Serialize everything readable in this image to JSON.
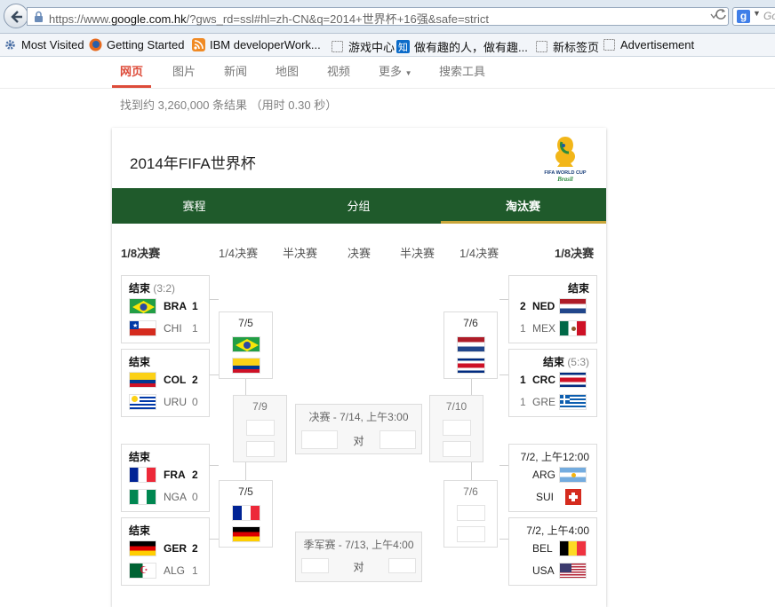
{
  "browser": {
    "url_prefix": "https://www.",
    "url_host": "google.com.hk",
    "url_rest": "/?gws_rd=ssl#hl=zh-CN&q=2014+世界杯+16强&safe=strict",
    "search_placeholder": "Go"
  },
  "bookmarks": [
    {
      "label": "Most Visited",
      "icon": "gear-icon"
    },
    {
      "label": "Getting Started",
      "icon": "firefox-icon"
    },
    {
      "label": "IBM developerWork...",
      "icon": "rss-icon"
    },
    {
      "label": "游戏中心",
      "icon": "page-icon"
    },
    {
      "label": "做有趣的人，做有趣...",
      "icon": "zhihu-icon"
    },
    {
      "label": "新标签页",
      "icon": "page-icon"
    },
    {
      "label": "Advertisement",
      "icon": "page-icon"
    }
  ],
  "google_tabs": [
    "网页",
    "图片",
    "新闻",
    "地图",
    "视频",
    "更多",
    "搜索工具"
  ],
  "result_stats": "找到约 3,260,000 条结果 （用时 0.30 秒）",
  "card": {
    "title": "2014年FIFA世界杯",
    "logo_text": "FIFA WORLD CUP",
    "logo_sub": "Brasil",
    "tabs": [
      "赛程",
      "分组",
      "淘汰赛"
    ],
    "rounds": [
      "1/8决赛",
      "1/4决赛",
      "半决赛",
      "决赛",
      "半决赛",
      "1/4决赛",
      "1/8决赛"
    ]
  },
  "r16": {
    "m1": {
      "status": "结束",
      "score_note": "(3:2)",
      "t1": {
        "code": "BRA",
        "score": "1"
      },
      "t2": {
        "code": "CHI",
        "score": "1"
      }
    },
    "m2": {
      "status": "结束",
      "score_note": "",
      "t1": {
        "code": "COL",
        "score": "2"
      },
      "t2": {
        "code": "URU",
        "score": "0"
      }
    },
    "m3": {
      "status": "结束",
      "score_note": "",
      "t1": {
        "code": "FRA",
        "score": "2"
      },
      "t2": {
        "code": "NGA",
        "score": "0"
      }
    },
    "m4": {
      "status": "结束",
      "score_note": "",
      "t1": {
        "code": "GER",
        "score": "2"
      },
      "t2": {
        "code": "ALG",
        "score": "1"
      }
    },
    "m5": {
      "status": "结束",
      "score_note": "",
      "t1": {
        "code": "NED",
        "score": "2"
      },
      "t2": {
        "code": "MEX",
        "score": "1"
      }
    },
    "m6": {
      "status": "结束",
      "score_note": "(5:3)",
      "t1": {
        "code": "CRC",
        "score": "1"
      },
      "t2": {
        "code": "GRE",
        "score": "1"
      }
    },
    "m7": {
      "status": "7/2, 上午12:00",
      "t1": {
        "code": "ARG"
      },
      "t2": {
        "code": "SUI"
      }
    },
    "m8": {
      "status": "7/2, 上午4:00",
      "t1": {
        "code": "BEL"
      },
      "t2": {
        "code": "USA"
      }
    }
  },
  "qf": {
    "q1": "7/5",
    "q2": "7/5",
    "q3": "7/6",
    "q4": "7/6"
  },
  "sf": {
    "s1": "7/9",
    "s2": "7/10"
  },
  "final": {
    "label": "决赛 - 7/14, 上午3:00",
    "vs": "对"
  },
  "third": {
    "label": "季军赛 - 7/13, 上午4:00",
    "vs": "对"
  }
}
